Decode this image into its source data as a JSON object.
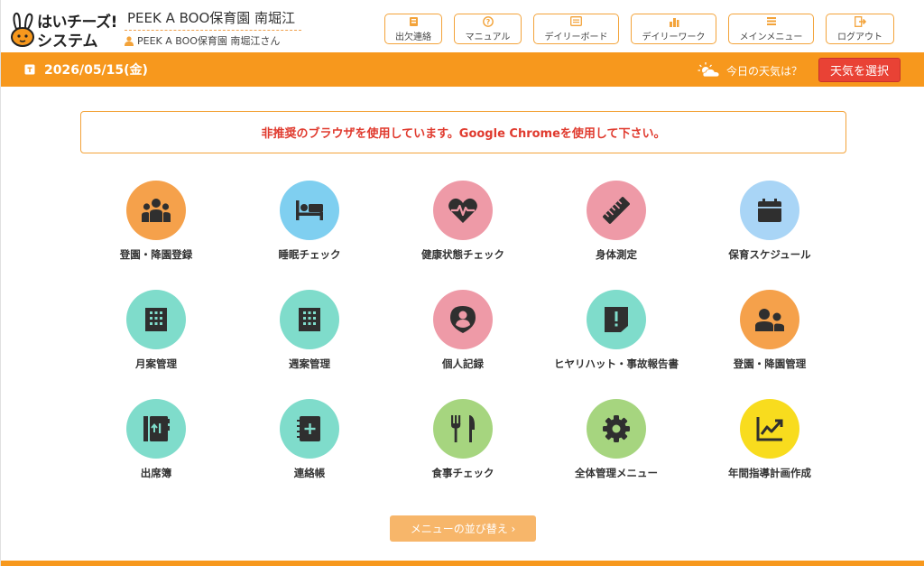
{
  "header": {
    "logo_line1": "はいチーズ!",
    "logo_line2": "システム",
    "facility_name": "PEEK A BOO保育園 南堀江",
    "user_label": "PEEK A BOO保育園 南堀江さん",
    "nav": [
      {
        "label": "出欠連絡",
        "icon": "attendance-icon"
      },
      {
        "label": "マニュアル",
        "icon": "question-icon"
      },
      {
        "label": "デイリーボード",
        "icon": "board-icon"
      },
      {
        "label": "デイリーワーク",
        "icon": "chart-bars-icon"
      },
      {
        "label": "メインメニュー",
        "icon": "menu-icon"
      },
      {
        "label": "ログアウト",
        "icon": "logout-icon"
      }
    ]
  },
  "datebar": {
    "date": "2026/05/15(金)",
    "weather_label": "今日の天気は？",
    "weather_button": "天気を選択"
  },
  "warning": "非推奨のブラウザを使用しています。Google Chromeを使用して下さい。",
  "menu": [
    {
      "label": "登園・降園登録",
      "icon": "group-people-icon",
      "color": "#f5a14b"
    },
    {
      "label": "睡眠チェック",
      "icon": "bed-icon",
      "color": "#7fcff0"
    },
    {
      "label": "健康状態チェック",
      "icon": "heart-pulse-icon",
      "color": "#ee9aa7"
    },
    {
      "label": "身体測定",
      "icon": "ruler-icon",
      "color": "#ee9aa7"
    },
    {
      "label": "保育スケジュール",
      "icon": "calendar-icon",
      "color": "#a9d5f6"
    },
    {
      "label": "月案管理",
      "icon": "building-icon",
      "color": "#7fdccb"
    },
    {
      "label": "週案管理",
      "icon": "building-icon",
      "color": "#7fdccb"
    },
    {
      "label": "個人記録",
      "icon": "person-pin-icon",
      "color": "#ee9aa7"
    },
    {
      "label": "ヒヤリハット・事故報告書",
      "icon": "report-alert-icon",
      "color": "#7fdccb"
    },
    {
      "label": "登園・降園管理",
      "icon": "two-people-icon",
      "color": "#f5a14b"
    },
    {
      "label": "出席簿",
      "icon": "attendance-book-icon",
      "color": "#7fdccb"
    },
    {
      "label": "連絡帳",
      "icon": "contact-book-icon",
      "color": "#7fdccb"
    },
    {
      "label": "食事チェック",
      "icon": "fork-knife-icon",
      "color": "#a6d57f"
    },
    {
      "label": "全体管理メニュー",
      "icon": "gear-icon",
      "color": "#a6d57f"
    },
    {
      "label": "年間指導計画作成",
      "icon": "trend-chart-icon",
      "color": "#f8dc1e"
    }
  ],
  "sort_button": "メニューの並び替え ›",
  "colors": {
    "accent": "#f7981d",
    "danger": "#e94235",
    "nav_border": "#f3a33a"
  }
}
